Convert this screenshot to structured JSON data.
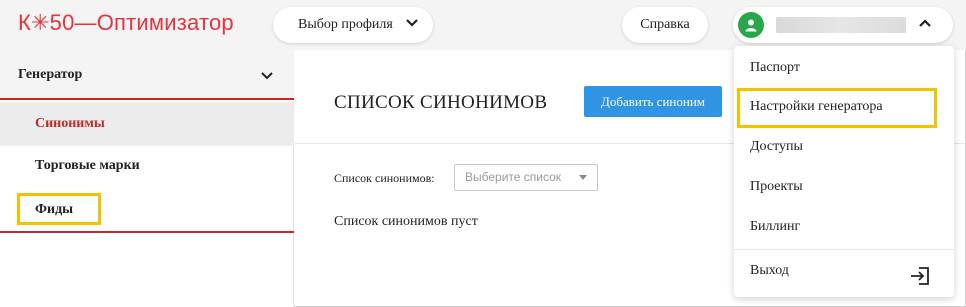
{
  "header": {
    "logo_text": "К✳50—Оптимизатор",
    "profile_button": "Выбор профиля",
    "help_button": "Справка",
    "user_name": ""
  },
  "sidebar": {
    "group_label": "Генератор",
    "items": [
      {
        "label": "Синонимы",
        "active": true
      },
      {
        "label": "Торговые марки",
        "active": false
      },
      {
        "label": "Фиды",
        "active": false
      }
    ]
  },
  "main": {
    "title": "СПИСОК СИНОНИМОВ",
    "add_button": "Добавить синоним",
    "field_label": "Список синонимов:",
    "select_placeholder": "Выберите список",
    "empty_text": "Список синонимов пуст"
  },
  "user_menu": {
    "items": [
      "Паспорт",
      "Настройки генератора",
      "Доступы",
      "Проекты",
      "Биллинг"
    ],
    "logout": "Выход"
  },
  "colors": {
    "brand_red": "#e8323c",
    "active_red": "#c62828",
    "primary_blue": "#2f94e3",
    "avatar_green": "#27a74a",
    "highlight_yellow": "#f2c400"
  }
}
